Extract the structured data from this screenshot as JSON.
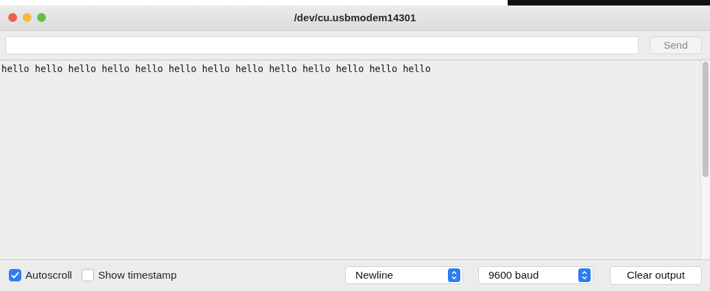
{
  "window": {
    "title": "/dev/cu.usbmodem14301"
  },
  "send_button": {
    "label": "Send",
    "disabled": true
  },
  "output": {
    "lines": [
      "hello hello hello hello hello hello hello hello hello hello hello hello hello"
    ]
  },
  "options": [
    {
      "label": "Autoscroll",
      "checked": true
    },
    {
      "label": "Show timestamp",
      "checked": false
    }
  ],
  "line_ending": {
    "value": "Newline"
  },
  "baud_rate": {
    "value": "9600 baud"
  },
  "clear_button": {
    "label": "Clear output"
  }
}
